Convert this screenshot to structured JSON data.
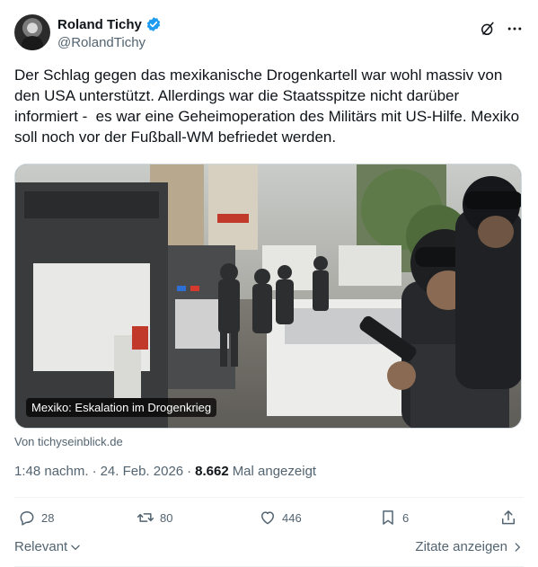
{
  "author": {
    "display_name": "Roland Tichy",
    "handle": "@RolandTichy",
    "verified": true
  },
  "tweet": {
    "text": "Der Schlag gegen das mexikanische Drogenkartell war wohl massiv von den USA unterstützt. Allerdings war die Staatsspitze nicht darüber informiert -  es war eine Geheimoperation des Militärs mit US-Hilfe. Mexiko soll noch vor der Fußball-WM befriedet werden.",
    "media_caption": "Mexiko: Eskalation im Drogenkrieg",
    "source": "Von tichyseinblick.de"
  },
  "meta": {
    "time": "1:48 nachm.",
    "separator1": "·",
    "date": "24. Feb. 2026",
    "separator2": "·",
    "views_count": "8.662",
    "views_label": "Mal angezeigt"
  },
  "actions": {
    "replies": "28",
    "reposts": "80",
    "likes": "446",
    "bookmarks": "6"
  },
  "footer": {
    "relevant_label": "Relevant",
    "quotes_label": "Zitate anzeigen"
  },
  "colors": {
    "accent": "#1d9bf0",
    "secondary_text": "#536471",
    "primary_text": "#0f1419"
  },
  "icons": [
    "verified-badge-icon",
    "grok-icon",
    "more-icon",
    "reply-icon",
    "repost-icon",
    "like-icon",
    "bookmark-icon",
    "share-icon",
    "chevron-down-icon",
    "chevron-right-icon"
  ]
}
